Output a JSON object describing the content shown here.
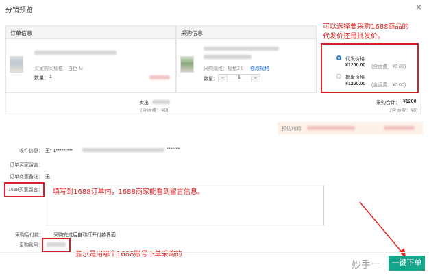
{
  "dialog": {
    "title": "分销预览",
    "close_glyph": "✕"
  },
  "order_panel": {
    "header": "订单信息",
    "spec": "买家购买规格：白色 M",
    "quantity_label": "数量：",
    "quantity_value": "1"
  },
  "purchase_panel": {
    "header": "采购信息",
    "spec": "采购规格：规格2 L",
    "modify_link": "修改规格",
    "quantity_label": "数量：",
    "stepper": {
      "minus": "−",
      "value": "1",
      "plus": "+"
    }
  },
  "price_options": {
    "dropship": {
      "label": "代发价格",
      "price": "¥1200.00",
      "freight": "(含运费：¥0.00)",
      "selected": true
    },
    "wholesale": {
      "label": "批发价格",
      "price": "¥1200.00",
      "freight": "(含运费：¥0.00)",
      "selected": false
    }
  },
  "totals": {
    "sold_label": "卖出",
    "sold_freight": "(含运费：¥0)",
    "purchase_total_label": "采购合计：",
    "purchase_total_value": "¥1200",
    "purchase_freight": "(含运费：¥0)"
  },
  "estimate": {
    "label": "预估利润"
  },
  "info": {
    "recipient_label": "收件信息：",
    "recipient_value": "王* 1*********",
    "recipient_tail": "*******",
    "order_buyer_msg_label": "订单买家留言：",
    "order_seller_note_label": "订单商家备注：",
    "order_seller_note_value": "无",
    "buyer_1688_msg_label": "1688买家留言：",
    "after_purchase_label": "采购后付款：",
    "after_purchase_value": "采购完成后自动打开付款界面",
    "account_label": "采购账号："
  },
  "annotations": {
    "top_right": "可以选择要采购1688商品的代发价还是批发价。",
    "top_right_line1": "可以选择要采购1688商品的",
    "top_right_line2": "代发价还是批发价。",
    "message": "填写到1688订单内，1688商家能看到留言信息。",
    "account": "显示是用哪个1688账号下单采购的",
    "color": "#e02020"
  },
  "submit": {
    "label": "一键下单"
  },
  "watermark": "妙手一",
  "colors": {
    "accent_blue": "#1f7bd6",
    "submit_green": "#14a58a",
    "annotation_red": "#d8202a"
  }
}
